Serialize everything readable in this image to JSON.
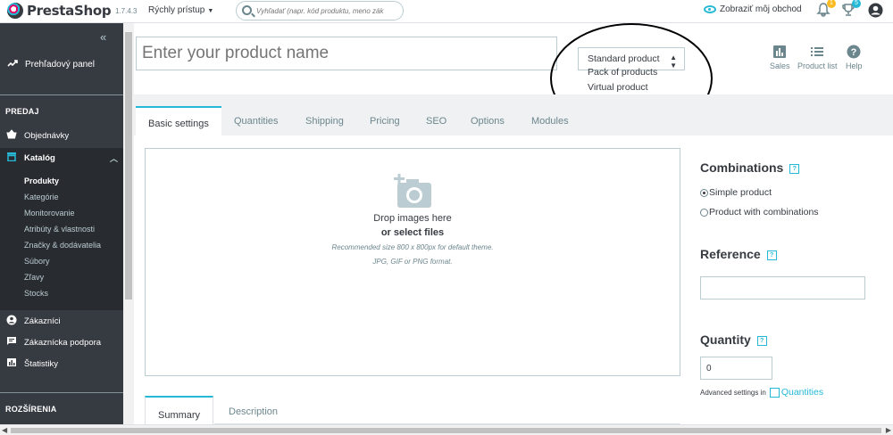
{
  "header": {
    "logo_text": "PrestaShop",
    "version": "1.7.4.3",
    "quick_access": "Rýchly prístup",
    "search_placeholder": "Vyhľadať (napr. kód produktu, meno zák",
    "view_store": "Zobraziť môj obchod",
    "notifications_badge": "1",
    "orders_badge": "5"
  },
  "sidebar": {
    "collapse_glyph": "«",
    "dashboard": "Prehľadový panel",
    "section_sell": "PREDAJ",
    "orders": "Objednávky",
    "catalog": "Katalóg",
    "catalog_sub": [
      "Produkty",
      "Kategórie",
      "Monitorovanie",
      "Atribúty & vlastnosti",
      "Značky & dodávatelia",
      "Súbory",
      "Zľavy",
      "Stocks"
    ],
    "customers": "Zákazníci",
    "support": "Zákaznícka podpora",
    "stats": "Štatistiky",
    "section_ext": "ROZŠÍRENIA"
  },
  "product": {
    "name_placeholder": "Enter your product name",
    "type_selected": "Standard product",
    "type_options": [
      "Pack of products",
      "Virtual product"
    ],
    "help": "?"
  },
  "toolbar": {
    "sales": "Sales",
    "product_list": "Product list",
    "help": "Help"
  },
  "tabs": [
    "Basic settings",
    "Quantities",
    "Shipping",
    "Pricing",
    "SEO",
    "Options",
    "Modules"
  ],
  "dropzone": {
    "line1": "Drop images here",
    "line2": "or select files",
    "line3": "Recommended size 800 x 800px for default theme.",
    "line4": "JPG, GIF or PNG format."
  },
  "panel": {
    "combinations_title": "Combinations",
    "simple_product": "Simple product",
    "with_combinations": "Product with combinations",
    "reference_title": "Reference",
    "reference_value": "",
    "quantity_title": "Quantity",
    "quantity_value": "0",
    "advanced_prefix": "Advanced settings in",
    "advanced_link": "Quantities"
  },
  "desc_tabs": [
    "Summary",
    "Description"
  ],
  "colors": {
    "accent": "#25b9d7",
    "sidebar_bg": "#363a41",
    "sidebar_active": "#282b30",
    "notification_badge": "#fbbb22",
    "orders_badge": "#25b9d7"
  }
}
